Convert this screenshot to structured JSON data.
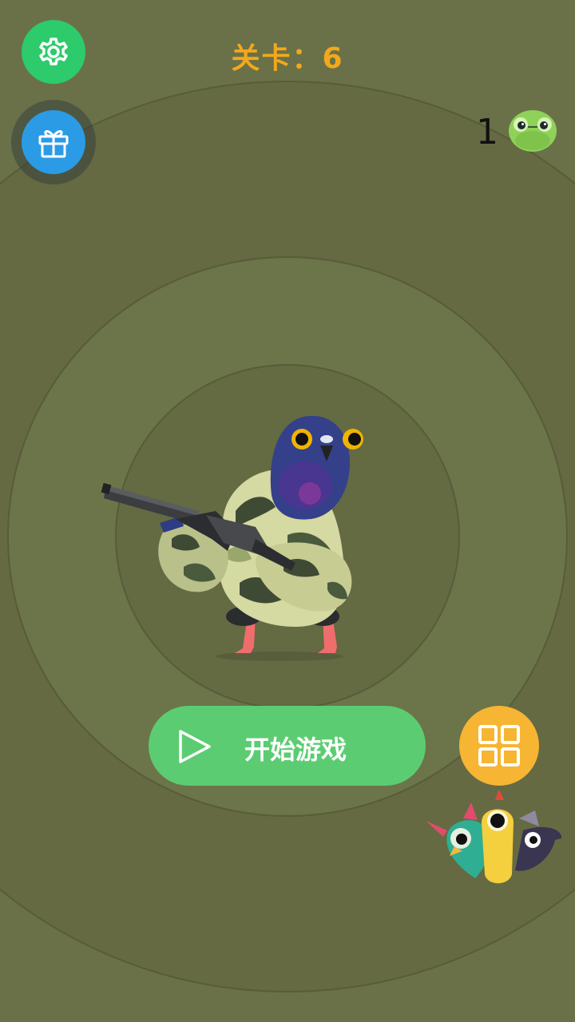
{
  "header": {
    "level_label": "关卡：",
    "level_value": "6"
  },
  "hud": {
    "enemy_count": "1"
  },
  "buttons": {
    "start_label": "开始游戏"
  },
  "colors": {
    "background": "#6a7148",
    "settings": "#2dcb6b",
    "gift": "#2b9be6",
    "start": "#5ccc72",
    "menu": "#f6b532",
    "level_text": "#f3a81c"
  },
  "icons": {
    "settings": "gear-icon",
    "gift": "gift-icon",
    "play": "play-icon",
    "menu": "grid-menu-icon"
  }
}
